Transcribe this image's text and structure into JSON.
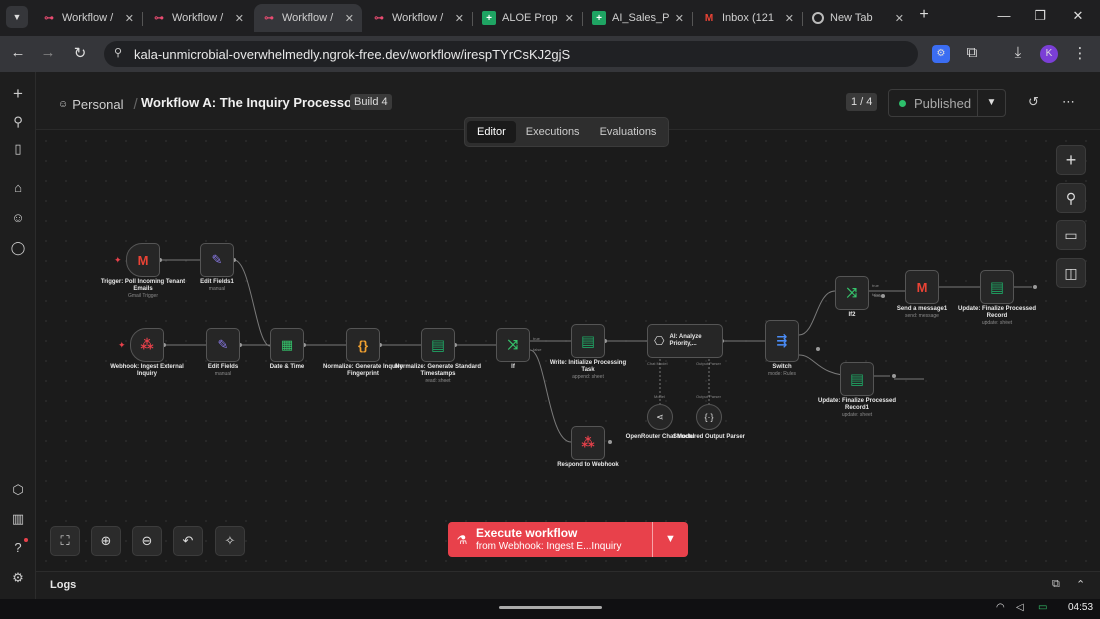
{
  "browser": {
    "tabs": [
      {
        "label": "Workflow /",
        "icon": "n8n-icon",
        "active": false
      },
      {
        "label": "Workflow /",
        "icon": "n8n-icon",
        "active": false
      },
      {
        "label": "Workflow /",
        "icon": "n8n-icon",
        "active": true
      },
      {
        "label": "Workflow /",
        "icon": "n8n-icon",
        "active": false
      },
      {
        "label": "ALOE Prop",
        "icon": "sheets-icon",
        "active": false
      },
      {
        "label": "AI_Sales_P",
        "icon": "sheets-icon",
        "active": false
      },
      {
        "label": "Inbox (121",
        "icon": "gmail-icon",
        "active": false
      },
      {
        "label": "New Tab",
        "icon": "chrome-icon",
        "active": false
      }
    ],
    "url": "kala-unmicrobial-overwhelmedly.ngrok-free.dev/workflow/irespTYrCsKJ2gjS",
    "profile_initial": "K"
  },
  "header": {
    "breadcrumb_project": "Personal",
    "breadcrumb_sep": "/",
    "workflow_title": "Workflow A: The Inquiry Processor",
    "build_badge": "Build 4",
    "page_counter": "1 / 4",
    "publish_label": "Published"
  },
  "view_tabs": {
    "editor": "Editor",
    "executions": "Executions",
    "evaluations": "Evaluations"
  },
  "nodes": {
    "trigger_email": {
      "label": "Trigger: Poll Incoming Tenant Emails",
      "sub": "Gmail Trigger"
    },
    "edit_fields1": {
      "label": "Edit Fields1",
      "sub": "manual"
    },
    "webhook": {
      "label": "Webhook: Ingest External Inquiry",
      "sub": ""
    },
    "edit_fields": {
      "label": "Edit Fields",
      "sub": "manual"
    },
    "date_time": {
      "label": "Date & Time",
      "sub": ""
    },
    "fingerprint": {
      "label": "Normalize: Generate Inquiry Fingerprint",
      "sub": ""
    },
    "timestamps": {
      "label": "Normalize: Generate Standard Timestamps",
      "sub": "read: sheet"
    },
    "if": {
      "label": "If",
      "sub": ""
    },
    "write_task": {
      "label": "Write: Initialize Processing Task",
      "sub": "append: sheet"
    },
    "respond": {
      "label": "Respond to Webhook",
      "sub": ""
    },
    "ai_analyze": {
      "label": "AI: Analyze Priority,...",
      "sub": ""
    },
    "openrouter": {
      "label": "OpenRouter Chat Model",
      "sub": ""
    },
    "parser": {
      "label": "Structured Output Parser",
      "sub": ""
    },
    "switch": {
      "label": "Switch",
      "sub": "mode: Rules"
    },
    "if2": {
      "label": "If2",
      "sub": ""
    },
    "send_message": {
      "label": "Send a message1",
      "sub": "send: message"
    },
    "update_final": {
      "label": "Update: Finalize Processed Record",
      "sub": "update: sheet"
    },
    "update_final1": {
      "label": "Update: Finalize Processed Record1",
      "sub": "update: sheet"
    }
  },
  "port_labels": {
    "true": "true",
    "false": "false",
    "chat_model": "Chat Model",
    "output_parser": "Output Parser",
    "model": "Model"
  },
  "execute": {
    "line1": "Execute workflow",
    "line2": "from Webhook: Ingest E...Inquiry"
  },
  "logs": {
    "title": "Logs"
  },
  "taskbar": {
    "clock": "04:53"
  }
}
